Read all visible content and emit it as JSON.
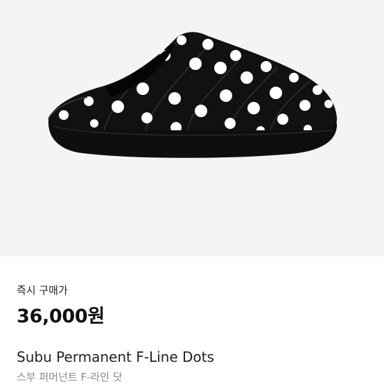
{
  "product": {
    "image_alt": "Subu Permanent F-Line Dots slipper",
    "buy_label": "즉시 구매가",
    "price": "36,000원",
    "name_en": "Subu Permanent F-Line Dots",
    "name_ko": "스부 퍼머넌트 F-라인 닷",
    "pattern_colors": {
      "body": "#111111",
      "dots": "#ffffff",
      "background": "#f4f4f4"
    }
  }
}
